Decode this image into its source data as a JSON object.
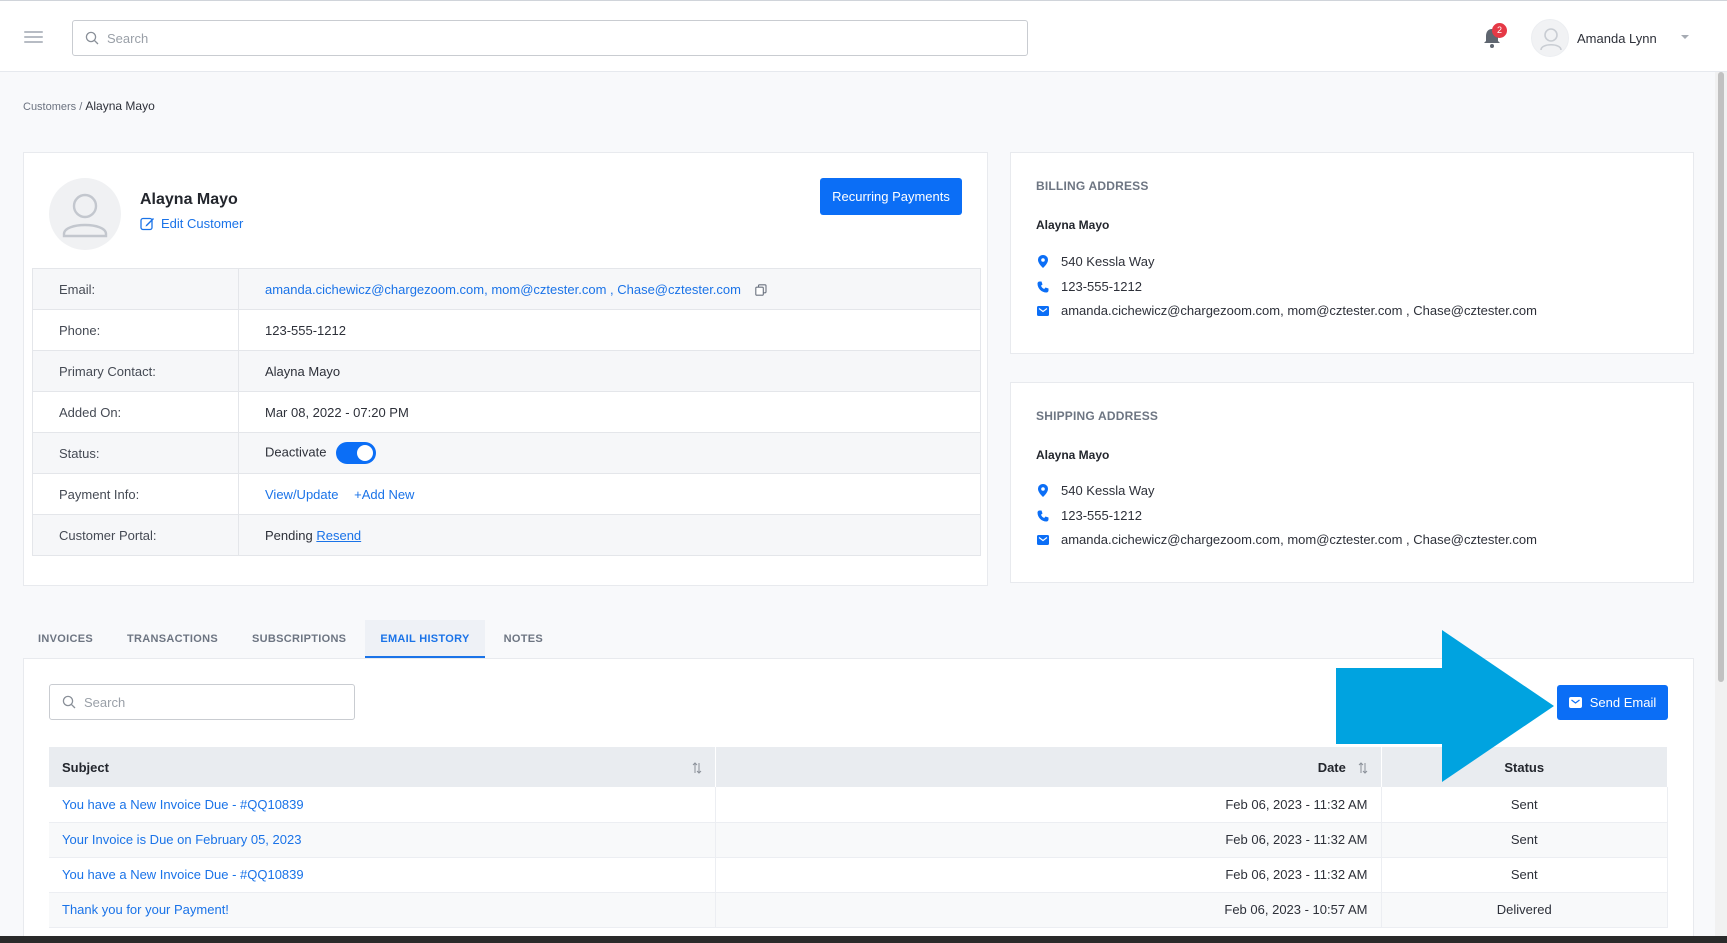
{
  "header": {
    "search_placeholder": "Search",
    "notification_count": "2",
    "user_name": "Amanda Lynn"
  },
  "breadcrumb": {
    "parent": "Customers",
    "separator": "/",
    "current": "Alayna Mayo"
  },
  "customer": {
    "name": "Alayna Mayo",
    "edit_label": "Edit Customer",
    "recurring_label": "Recurring Payments",
    "fields": {
      "email_label": "Email:",
      "email_value": "amanda.cichewicz@chargezoom.com, mom@cztester.com , Chase@cztester.com",
      "phone_label": "Phone:",
      "phone_value": "123-555-1212",
      "primary_label": "Primary Contact:",
      "primary_value": "Alayna Mayo",
      "added_label": "Added On:",
      "added_value": "Mar 08, 2022 - 07:20 PM",
      "status_label": "Status:",
      "status_value": "Deactivate",
      "status_on": true,
      "payment_label": "Payment Info:",
      "payment_view": "View/Update",
      "payment_add": "+Add New",
      "portal_label": "Customer Portal:",
      "portal_status": "Pending",
      "portal_resend": "Resend"
    }
  },
  "billing": {
    "title": "BILLING ADDRESS",
    "name": "Alayna Mayo",
    "street": "540 Kessla Way",
    "phone": "123-555-1212",
    "email": "amanda.cichewicz@chargezoom.com, mom@cztester.com , Chase@cztester.com"
  },
  "shipping": {
    "title": "SHIPPING ADDRESS",
    "name": "Alayna Mayo",
    "street": "540 Kessla Way",
    "phone": "123-555-1212",
    "email": "amanda.cichewicz@chargezoom.com, mom@cztester.com , Chase@cztester.com"
  },
  "tabs": [
    {
      "label": "INVOICES",
      "active": false
    },
    {
      "label": "TRANSACTIONS",
      "active": false
    },
    {
      "label": "SUBSCRIPTIONS",
      "active": false
    },
    {
      "label": "EMAIL HISTORY",
      "active": true
    },
    {
      "label": "NOTES",
      "active": false
    }
  ],
  "email_history": {
    "search_placeholder": "Search",
    "send_label": "Send Email",
    "columns": {
      "subject": "Subject",
      "date": "Date",
      "status": "Status"
    },
    "rows": [
      {
        "subject": "You have a New Invoice Due - #QQ10839",
        "date": "Feb 06, 2023 - 11:32 AM",
        "status": "Sent"
      },
      {
        "subject": "Your Invoice is Due on February 05, 2023",
        "date": "Feb 06, 2023 - 11:32 AM",
        "status": "Sent"
      },
      {
        "subject": "You have a New Invoice Due - #QQ10839",
        "date": "Feb 06, 2023 - 11:32 AM",
        "status": "Sent"
      },
      {
        "subject": "Thank you for your Payment!",
        "date": "Feb 06, 2023 - 10:57 AM",
        "status": "Delivered"
      }
    ]
  },
  "colors": {
    "accent": "#0b6ef6",
    "link": "#1a73e8",
    "annotation_arrow": "#00a3e0",
    "badge": "#e53946"
  }
}
